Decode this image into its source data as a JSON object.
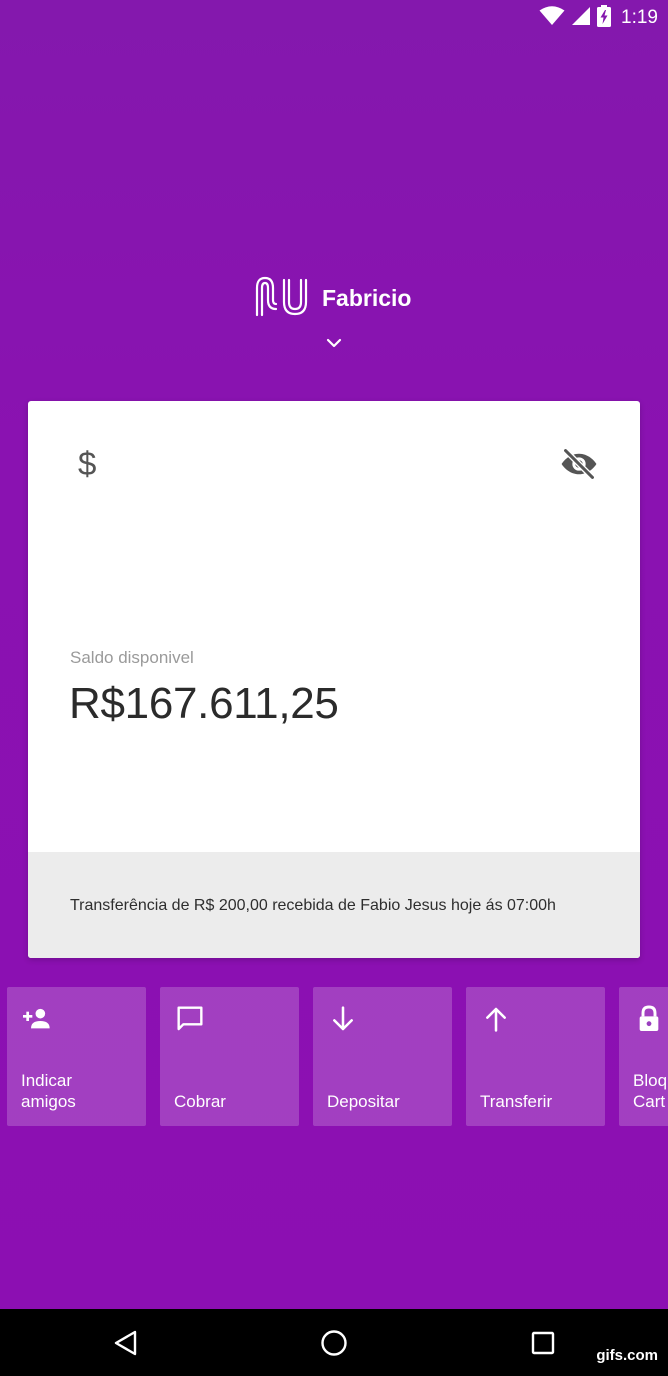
{
  "status_bar": {
    "time": "1:19",
    "icons": [
      "wifi-icon",
      "cell-signal-icon",
      "battery-icon"
    ]
  },
  "header": {
    "logo": "nu-logo",
    "user_name": "Fabricio",
    "chevron": "chevron-down-icon"
  },
  "card": {
    "balance_label": "Saldo disponivel",
    "balance_value": "R$167.611,25",
    "notification": "Transferência de R$ 200,00 recebida de Fabio Jesus hoje ás 07:00h"
  },
  "actions": [
    {
      "label": "Indicar\namigos",
      "icon": "add-person-icon"
    },
    {
      "label": "Cobrar",
      "icon": "message-icon"
    },
    {
      "label": "Depositar",
      "icon": "arrow-down-icon"
    },
    {
      "label": "Transferir",
      "icon": "arrow-up-icon"
    },
    {
      "label": "Bloq\nCart",
      "icon": "lock-icon"
    }
  ],
  "nav_bar": {
    "buttons": [
      "back-icon",
      "home-icon",
      "recents-icon"
    ],
    "watermark": "gifs.com"
  },
  "colors": {
    "background": "#8a10b0",
    "card": "#ffffff",
    "card_footer": "#ececec",
    "tile": "rgba(255,255,255,0.20)",
    "text_dark": "#2b2b2b",
    "text_muted": "#9a9a9a"
  }
}
